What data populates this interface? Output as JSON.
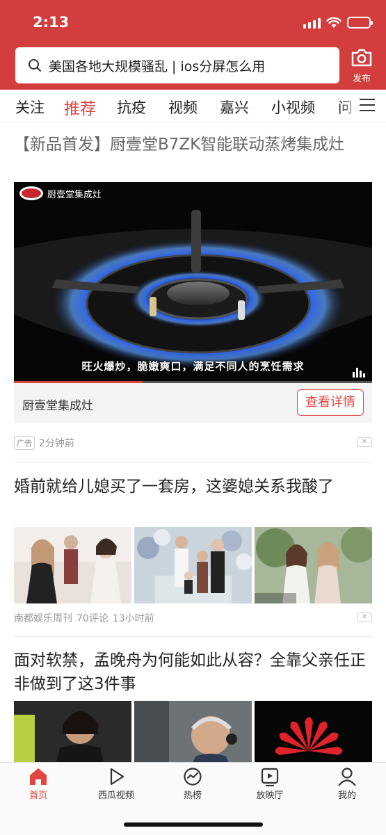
{
  "status": {
    "time": "2:13"
  },
  "search": {
    "text": "美国各地大规模骚乱 | ios分屏怎么用"
  },
  "publish": {
    "label": "发布"
  },
  "tabs": [
    {
      "label": "关注"
    },
    {
      "label": "推荐",
      "active": true
    },
    {
      "label": "抗疫"
    },
    {
      "label": "视频"
    },
    {
      "label": "嘉兴"
    },
    {
      "label": "小视频"
    },
    {
      "label": "问"
    }
  ],
  "ad": {
    "title": "【新品首发】厨壹堂B7ZK智能联动蒸烤集成灶",
    "brand_overlay": "厨壹堂集成灶",
    "caption": "旺火爆炒，脆嫩爽口，满足不同人的烹饪需求",
    "advertiser": "厨壹堂集成灶",
    "cta": "查看详情",
    "tag": "广告",
    "time": "2分钟前",
    "video_progress": 0.36
  },
  "articles": [
    {
      "title": "婚前就给儿媳买了一套房，这婆媳关系我酸了",
      "source": "南都娱乐周刊",
      "comments": "70评论",
      "time": "13小时前"
    },
    {
      "title": "面对软禁，孟晚舟为何能如此从容？全靠父亲任正非做到了这3件事"
    }
  ],
  "bottom_nav": [
    {
      "label": "首页",
      "icon": "home-icon",
      "active": true
    },
    {
      "label": "西瓜视频",
      "icon": "play-icon"
    },
    {
      "label": "热榜",
      "icon": "trending-icon"
    },
    {
      "label": "放映厅",
      "icon": "theater-icon"
    },
    {
      "label": "我的",
      "icon": "user-icon"
    }
  ],
  "colors": {
    "header": "#d43d3d",
    "accent": "#e0453f"
  }
}
